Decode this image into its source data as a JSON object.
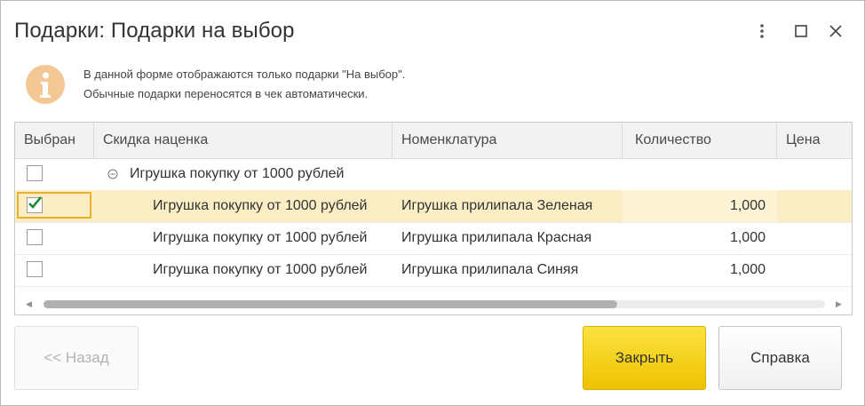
{
  "window": {
    "title": "Подарки: Подарки на выбор",
    "controls": [
      "more-icon",
      "maximize-icon",
      "close-icon"
    ]
  },
  "info": {
    "icon": "info-icon",
    "line1": "В данной форме отображаются только подарки \"На выбор\".",
    "line2": "Обычные подарки переносятся в чек автоматически."
  },
  "table": {
    "columns": [
      "Выбран",
      "Скидка наценка",
      "Номенклатура",
      "Количество",
      "Цена"
    ],
    "group_row": {
      "checked": false,
      "label": "Игрушка покупку от 1000 рублей"
    },
    "rows": [
      {
        "checked": true,
        "discount": "Игрушка покупку от 1000 рублей",
        "item": "Игрушка прилипала Зеленая",
        "quantity": "1,000",
        "price": ""
      },
      {
        "checked": false,
        "discount": "Игрушка покупку от 1000 рублей",
        "item": "Игрушка прилипала Красная",
        "quantity": "1,000",
        "price": ""
      },
      {
        "checked": false,
        "discount": "Игрушка покупку от 1000 рублей",
        "item": "Игрушка прилипала Синяя",
        "quantity": "1,000",
        "price": ""
      }
    ]
  },
  "buttons": {
    "back": "<< Назад",
    "close": "Закрыть",
    "help": "Справка"
  },
  "colors": {
    "accent": "#f1c700",
    "selected_row": "#fbeec4",
    "info_icon": "#f3c895"
  }
}
